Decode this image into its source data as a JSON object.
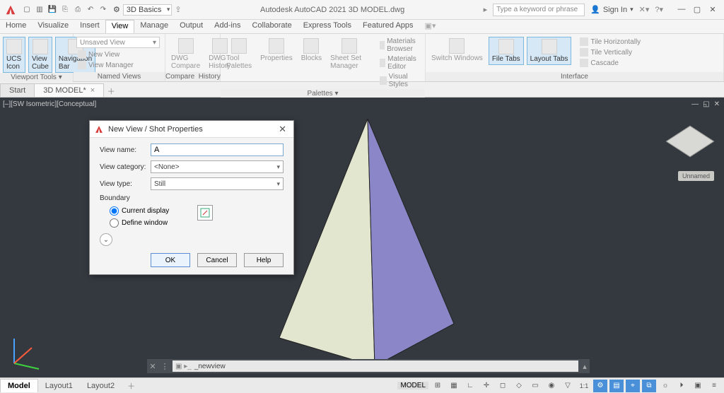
{
  "app_title": "Autodesk AutoCAD 2021   3D MODEL.dwg",
  "workspace": "3D Basics",
  "search_placeholder": "Type a keyword or phrase",
  "signin_label": "Sign In",
  "menu_tabs": [
    "Home",
    "Visualize",
    "Insert",
    "View",
    "Manage",
    "Output",
    "Add-ins",
    "Collaborate",
    "Express Tools",
    "Featured Apps"
  ],
  "active_menu_tab": "View",
  "ribbon": {
    "viewport": {
      "label": "Viewport Tools ▾",
      "ucs": "UCS Icon",
      "viewcube": "View Cube",
      "navbar": "Navigation Bar"
    },
    "named_views": {
      "label": "Named Views",
      "dropdown": "Unsaved View",
      "new_view": "New View",
      "view_manager": "View Manager"
    },
    "compare_history": {
      "label_l": "Compare",
      "label_r": "History",
      "dwg_compare": "DWG Compare",
      "dwg_history": "DWG History"
    },
    "palettes": {
      "label": "Palettes ▾",
      "tool": "Tool Palettes",
      "props": "Properties",
      "blocks": "Blocks",
      "ssm": "Sheet Set Manager",
      "mat_browser": "Materials Browser",
      "mat_editor": "Materials Editor",
      "vstyles": "Visual Styles"
    },
    "interface": {
      "label": "Interface",
      "switch": "Switch Windows",
      "file_tabs": "File Tabs",
      "layout_tabs": "Layout Tabs",
      "tile_h": "Tile Horizontally",
      "tile_v": "Tile Vertically",
      "cascade": "Cascade"
    }
  },
  "file_tabs": {
    "start": "Start",
    "doc": "3D MODEL*"
  },
  "viewport_label": "[–][SW Isometric][Conceptual]",
  "viewcube_label": "Unnamed",
  "command": {
    "text": "_newview"
  },
  "layout_tabs": {
    "model": "Model",
    "l1": "Layout1",
    "l2": "Layout2"
  },
  "status_model": "MODEL",
  "dialog": {
    "title": "New View / Shot Properties",
    "view_name_label": "View name:",
    "view_name_value": "A",
    "view_category_label": "View category:",
    "view_category_value": "<None>",
    "view_type_label": "View type:",
    "view_type_value": "Still",
    "boundary_label": "Boundary",
    "opt_current": "Current display",
    "opt_define": "Define window",
    "ok": "OK",
    "cancel": "Cancel",
    "help": "Help"
  }
}
